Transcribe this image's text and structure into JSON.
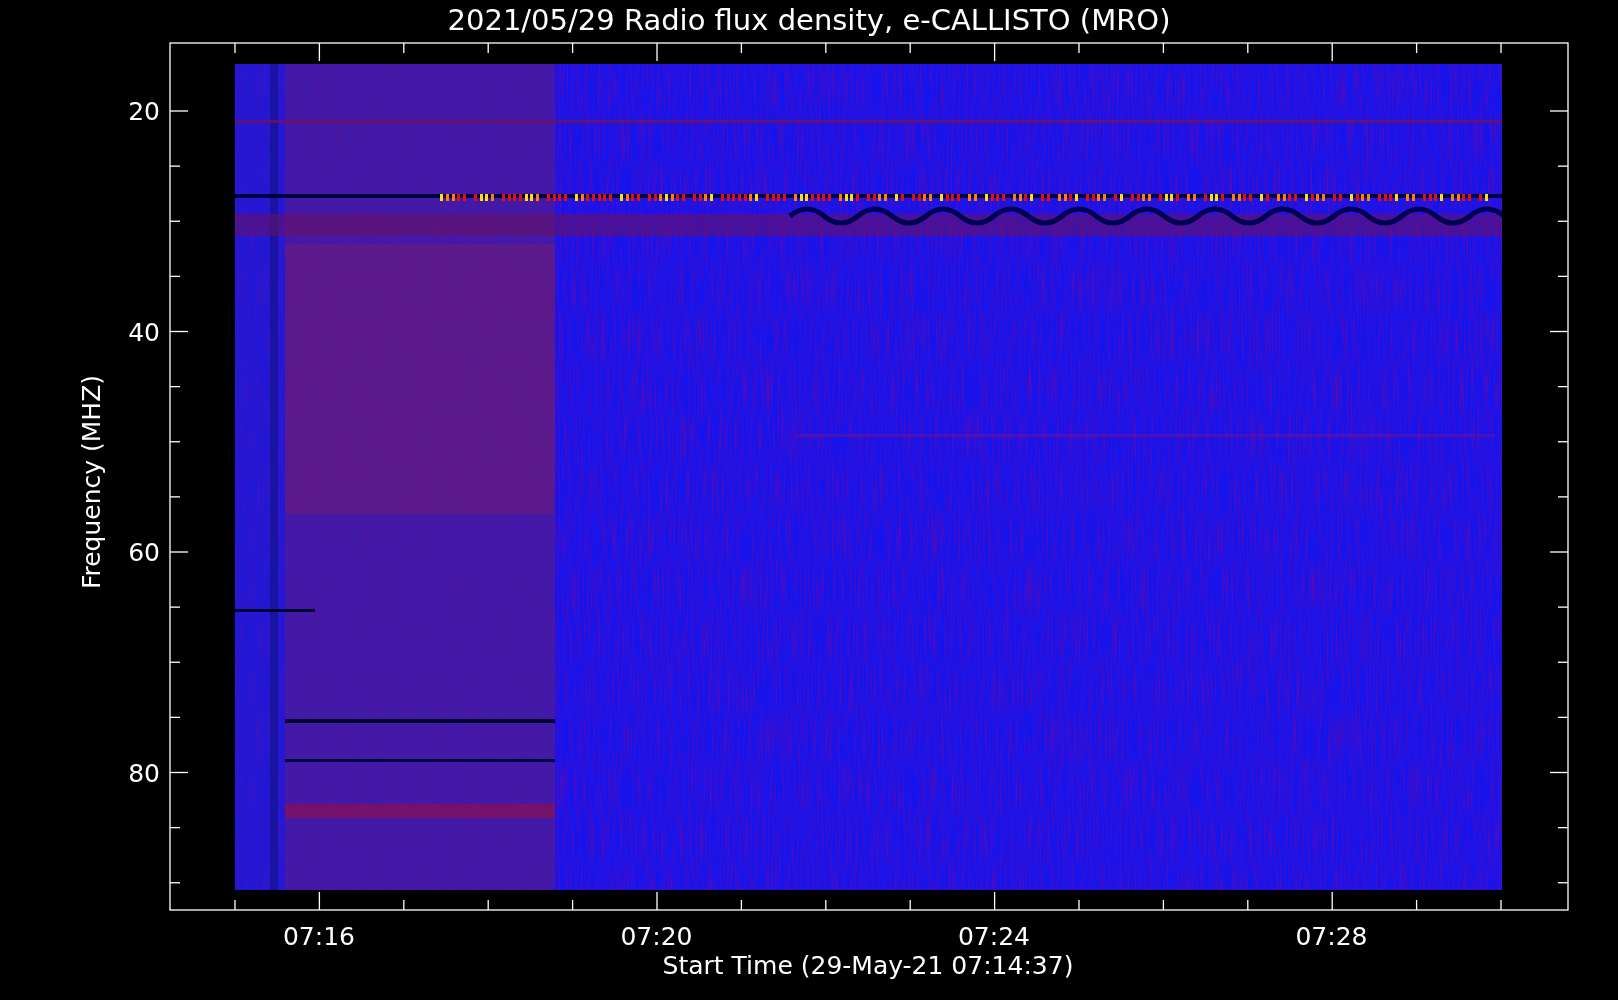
{
  "plot": {
    "title": "2021/05/29  Radio flux density, e-CALLISTO (MRO)",
    "y_axis": {
      "label": "Frequency (MHZ)",
      "ticks": [
        "20",
        "40",
        "60",
        "80"
      ]
    },
    "x_axis": {
      "label": "Start Time (29-May-21 07:14:37)",
      "ticks": [
        "07:16",
        "07:20",
        "07:24",
        "07:28"
      ]
    }
  }
}
